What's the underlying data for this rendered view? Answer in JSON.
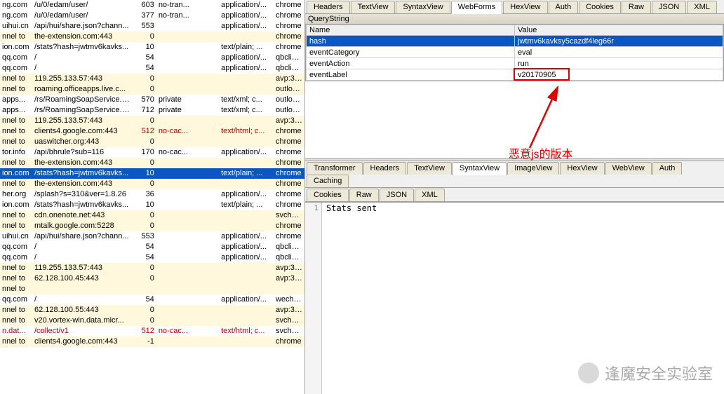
{
  "sessions": [
    {
      "host": "ng.com",
      "url": "/u/0/edam/user/",
      "body": "603",
      "cache": "no-tran...",
      "priv": "",
      "ctype": "application/...",
      "proc": "chrome",
      "cls": ""
    },
    {
      "host": "ng.com",
      "url": "/u/0/edam/user/",
      "body": "377",
      "cache": "no-tran...",
      "priv": "",
      "ctype": "application/...",
      "proc": "chrome",
      "cls": ""
    },
    {
      "host": "uihui.cn",
      "url": "/api/hui/share.json?chann...",
      "body": "553",
      "cache": "",
      "priv": "",
      "ctype": "application/...",
      "proc": "chrome",
      "cls": ""
    },
    {
      "host": "nnel to",
      "url": "the-extension.com:443",
      "body": "0",
      "cache": "",
      "priv": "",
      "ctype": "",
      "proc": "chrome",
      "cls": "yellow"
    },
    {
      "host": "ion.com",
      "url": "/stats?hash=jwtmv6kavks...",
      "body": "10",
      "cache": "",
      "priv": "",
      "ctype": "text/plain; ...",
      "proc": "chrome",
      "cls": ""
    },
    {
      "host": "qq.com",
      "url": "/",
      "body": "54",
      "cache": "",
      "priv": "",
      "ctype": "application/...",
      "proc": "qbclien...",
      "cls": ""
    },
    {
      "host": "qq.com",
      "url": "/",
      "body": "54",
      "cache": "",
      "priv": "",
      "ctype": "application/...",
      "proc": "qbclien...",
      "cls": ""
    },
    {
      "host": "nnel to",
      "url": "119.255.133.57:443",
      "body": "0",
      "cache": "",
      "priv": "",
      "ctype": "",
      "proc": "avp:37...",
      "cls": "yellow"
    },
    {
      "host": "nnel to",
      "url": "roaming.officeapps.live.c...",
      "body": "0",
      "cache": "",
      "priv": "",
      "ctype": "",
      "proc": "outlook...",
      "cls": "yellow"
    },
    {
      "host": "apps...",
      "url": "/rs/RoamingSoapService.svc",
      "body": "570",
      "cache": "private",
      "priv": "",
      "ctype": "text/xml; c...",
      "proc": "outlook...",
      "cls": ""
    },
    {
      "host": "apps...",
      "url": "/rs/RoamingSoapService.svc",
      "body": "712",
      "cache": "private",
      "priv": "",
      "ctype": "text/xml; c...",
      "proc": "outlook...",
      "cls": ""
    },
    {
      "host": "nnel to",
      "url": "119.255.133.57:443",
      "body": "0",
      "cache": "",
      "priv": "",
      "ctype": "",
      "proc": "avp:37...",
      "cls": "yellow"
    },
    {
      "host": "nnel to",
      "url": "clients4.google.com:443",
      "body": "512",
      "cache": "no-cac...",
      "priv": "",
      "ctype": "text/html; c...",
      "proc": "chrome",
      "cls": "yellow red512"
    },
    {
      "host": "nnel to",
      "url": "uaswitcher.org:443",
      "body": "0",
      "cache": "",
      "priv": "",
      "ctype": "",
      "proc": "chrome",
      "cls": "yellow"
    },
    {
      "host": "tor.info",
      "url": "/api/bhrule?sub=116",
      "body": "170",
      "cache": "no-cac...",
      "priv": "",
      "ctype": "application/...",
      "proc": "chrome",
      "cls": ""
    },
    {
      "host": "nnel to",
      "url": "the-extension.com:443",
      "body": "0",
      "cache": "",
      "priv": "",
      "ctype": "",
      "proc": "chrome",
      "cls": "yellow"
    },
    {
      "host": "ion.com",
      "url": "/stats?hash=jwtmv6kavks...",
      "body": "10",
      "cache": "",
      "priv": "",
      "ctype": "text/plain; ...",
      "proc": "chrome",
      "cls": "sel"
    },
    {
      "host": "nnel to",
      "url": "the-extension.com:443",
      "body": "0",
      "cache": "",
      "priv": "",
      "ctype": "",
      "proc": "chrome",
      "cls": "yellow"
    },
    {
      "host": "her.org",
      "url": "/splash?s=310&ver=1.8.26",
      "body": "36",
      "cache": "",
      "priv": "",
      "ctype": "application/...",
      "proc": "chrome",
      "cls": ""
    },
    {
      "host": "ion.com",
      "url": "/stats?hash=jwtmv6kavks...",
      "body": "10",
      "cache": "",
      "priv": "",
      "ctype": "text/plain; ...",
      "proc": "chrome",
      "cls": ""
    },
    {
      "host": "nnel to",
      "url": "cdn.onenote.net:443",
      "body": "0",
      "cache": "",
      "priv": "",
      "ctype": "",
      "proc": "svchos...",
      "cls": "yellow"
    },
    {
      "host": "nnel to",
      "url": "mtalk.google.com:5228",
      "body": "0",
      "cache": "",
      "priv": "",
      "ctype": "",
      "proc": "chrome",
      "cls": "yellow"
    },
    {
      "host": "uihui.cn",
      "url": "/api/hui/share.json?chann...",
      "body": "553",
      "cache": "",
      "priv": "",
      "ctype": "application/...",
      "proc": "chrome",
      "cls": ""
    },
    {
      "host": "qq.com",
      "url": "/",
      "body": "54",
      "cache": "",
      "priv": "",
      "ctype": "application/...",
      "proc": "qbclien...",
      "cls": ""
    },
    {
      "host": "qq.com",
      "url": "/",
      "body": "54",
      "cache": "",
      "priv": "",
      "ctype": "application/...",
      "proc": "qbclien...",
      "cls": ""
    },
    {
      "host": "nnel to",
      "url": "119.255.133.57:443",
      "body": "0",
      "cache": "",
      "priv": "",
      "ctype": "",
      "proc": "avp:37...",
      "cls": "yellow"
    },
    {
      "host": "nnel to",
      "url": "62.128.100.45:443",
      "body": "0",
      "cache": "",
      "priv": "",
      "ctype": "",
      "proc": "avp:37...",
      "cls": "yellow"
    },
    {
      "host": "nnel to",
      "url": "",
      "body": "",
      "cache": "",
      "priv": "",
      "ctype": "",
      "proc": "",
      "cls": "yellow"
    },
    {
      "host": "qq.com",
      "url": "/",
      "body": "54",
      "cache": "",
      "priv": "",
      "ctype": "application/...",
      "proc": "wechat...",
      "cls": ""
    },
    {
      "host": "nnel to",
      "url": "62.128.100.55:443",
      "body": "0",
      "cache": "",
      "priv": "",
      "ctype": "",
      "proc": "avp:37...",
      "cls": "yellow"
    },
    {
      "host": "nnel to",
      "url": "v20.vortex-win.data.micr...",
      "body": "0",
      "cache": "",
      "priv": "",
      "ctype": "",
      "proc": "svchos...",
      "cls": "yellow"
    },
    {
      "host": "n.dat...",
      "url": "/collect/v1",
      "body": "512",
      "cache": "no-cac...",
      "priv": "",
      "ctype": "text/html; c...",
      "proc": "svchos...",
      "cls": "redhost red512"
    },
    {
      "host": "nnel to",
      "url": "clients4.google.com:443",
      "body": "-1",
      "cache": "",
      "priv": "",
      "ctype": "",
      "proc": "chrome",
      "cls": "yellow"
    }
  ],
  "request_tabs": [
    "Headers",
    "TextView",
    "SyntaxView",
    "WebForms",
    "HexView",
    "Auth",
    "Cookies",
    "Raw",
    "JSON",
    "XML"
  ],
  "request_selected_tab": "WebForms",
  "section_header": "QueryString",
  "nv_headers": {
    "name": "Name",
    "value": "Value"
  },
  "querystring": [
    {
      "name": "hash",
      "value": "jwtmv6kavksy5cazdf4leg66r",
      "sel": true
    },
    {
      "name": "eventCategory",
      "value": "eval"
    },
    {
      "name": "eventAction",
      "value": "run"
    },
    {
      "name": "eventLabel",
      "value": "v20170905",
      "highlight": true
    }
  ],
  "annotation": "恶意js的版本",
  "response_tabs_row1": [
    "Transformer",
    "Headers",
    "TextView",
    "SyntaxView",
    "ImageView",
    "HexView",
    "WebView",
    "Auth",
    "Caching"
  ],
  "response_tabs_row2": [
    "Cookies",
    "Raw",
    "JSON",
    "XML"
  ],
  "response_selected_tab": "SyntaxView",
  "response_gutter": "1",
  "response_text": "Stats sent",
  "watermark": "逢魔安全实验室"
}
